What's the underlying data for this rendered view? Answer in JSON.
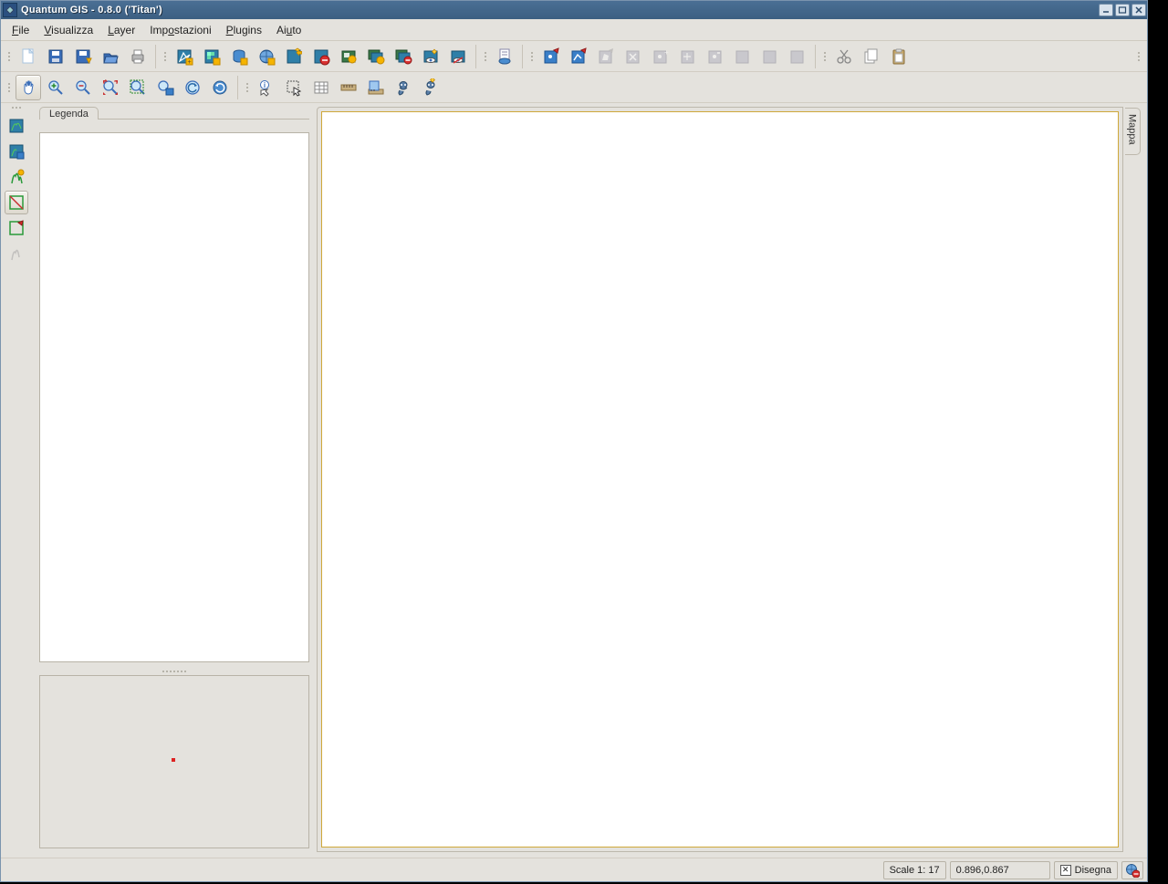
{
  "title": "Quantum GIS - 0.8.0 ('Titan')",
  "menu": {
    "file": "File",
    "view": "Visualizza",
    "layer": "Layer",
    "settings": "Impostazioni",
    "plugins": "Plugins",
    "help": "Aiuto"
  },
  "panel": {
    "legend_tab": "Legenda",
    "map_tab": "Mappa"
  },
  "status": {
    "scale": "Scale 1: 17",
    "coords": "0.896,0.867",
    "render_label": "Disegna"
  }
}
